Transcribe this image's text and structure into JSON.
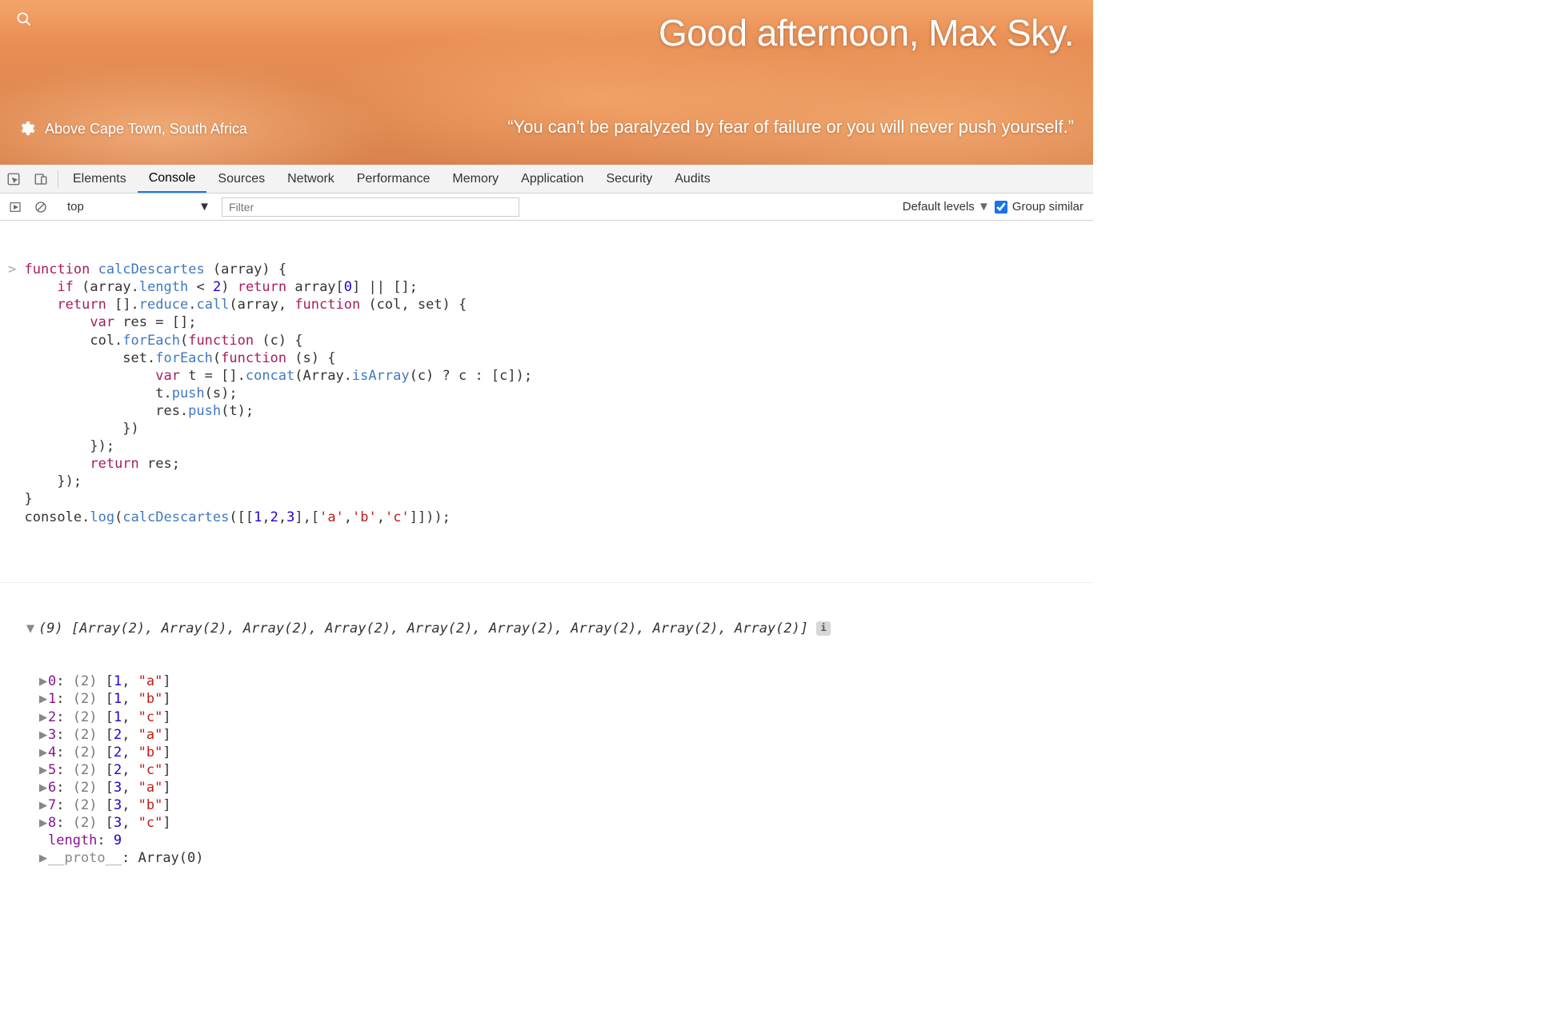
{
  "hero": {
    "greeting": "Good afternoon, Max Sky.",
    "quote": "“You can't be paralyzed by fear of failure or you will never push yourself.”",
    "location": "Above Cape Town, South Africa"
  },
  "devtools": {
    "tabs": [
      "Elements",
      "Console",
      "Sources",
      "Network",
      "Performance",
      "Memory",
      "Application",
      "Security",
      "Audits"
    ],
    "active_tab": "Console"
  },
  "console_toolbar": {
    "context": "top",
    "filter_placeholder": "Filter",
    "levels_label": "Default levels",
    "group_similar_label": "Group similar",
    "group_similar_checked": true
  },
  "code_tokens": [
    [
      [
        "prompt",
        "> "
      ],
      [
        "kw",
        "function"
      ],
      [
        "pl",
        " "
      ],
      [
        "nm",
        "calcDescartes"
      ],
      [
        "pl",
        " ("
      ],
      [
        "pl",
        "array"
      ],
      [
        "pl",
        ") {"
      ]
    ],
    [
      [
        "pl",
        "      "
      ],
      [
        "kw",
        "if"
      ],
      [
        "pl",
        " ("
      ],
      [
        "pl",
        "array"
      ],
      [
        "pl",
        "."
      ],
      [
        "nm",
        "length"
      ],
      [
        "pl",
        " < "
      ],
      [
        "num",
        "2"
      ],
      [
        "pl",
        ") "
      ],
      [
        "kw",
        "return"
      ],
      [
        "pl",
        " array["
      ],
      [
        "num",
        "0"
      ],
      [
        "pl",
        "] || [];"
      ]
    ],
    [
      [
        "pl",
        "      "
      ],
      [
        "kw",
        "return"
      ],
      [
        "pl",
        " []."
      ],
      [
        "nm",
        "reduce"
      ],
      [
        "pl",
        "."
      ],
      [
        "nm",
        "call"
      ],
      [
        "pl",
        "(array, "
      ],
      [
        "kw",
        "function"
      ],
      [
        "pl",
        " (col, set) {"
      ]
    ],
    [
      [
        "pl",
        "          "
      ],
      [
        "kw",
        "var"
      ],
      [
        "pl",
        " res = [];"
      ]
    ],
    [
      [
        "pl",
        "          col."
      ],
      [
        "nm",
        "forEach"
      ],
      [
        "pl",
        "("
      ],
      [
        "kw",
        "function"
      ],
      [
        "pl",
        " (c) {"
      ]
    ],
    [
      [
        "pl",
        "              set."
      ],
      [
        "nm",
        "forEach"
      ],
      [
        "pl",
        "("
      ],
      [
        "kw",
        "function"
      ],
      [
        "pl",
        " (s) {"
      ]
    ],
    [
      [
        "pl",
        "                  "
      ],
      [
        "kw",
        "var"
      ],
      [
        "pl",
        " t = []."
      ],
      [
        "nm",
        "concat"
      ],
      [
        "pl",
        "(Array."
      ],
      [
        "nm",
        "isArray"
      ],
      [
        "pl",
        "(c) ? c : [c]);"
      ]
    ],
    [
      [
        "pl",
        "                  t."
      ],
      [
        "nm",
        "push"
      ],
      [
        "pl",
        "(s);"
      ]
    ],
    [
      [
        "pl",
        "                  res."
      ],
      [
        "nm",
        "push"
      ],
      [
        "pl",
        "(t);"
      ]
    ],
    [
      [
        "pl",
        "              })"
      ]
    ],
    [
      [
        "pl",
        "          });"
      ]
    ],
    [
      [
        "pl",
        "          "
      ],
      [
        "kw",
        "return"
      ],
      [
        "pl",
        " res;"
      ]
    ],
    [
      [
        "pl",
        "      });"
      ]
    ],
    [
      [
        "pl",
        "  }"
      ]
    ],
    [
      [
        "pl",
        ""
      ]
    ],
    [
      [
        "pl",
        "  console."
      ],
      [
        "nm",
        "log"
      ],
      [
        "pl",
        "("
      ],
      [
        "nm",
        "calcDescartes"
      ],
      [
        "pl",
        "([["
      ],
      [
        "num",
        "1"
      ],
      [
        "pl",
        ","
      ],
      [
        "num",
        "2"
      ],
      [
        "pl",
        ","
      ],
      [
        "num",
        "3"
      ],
      [
        "pl",
        "],["
      ],
      [
        "val-str",
        "'a'"
      ],
      [
        "pl",
        ","
      ],
      [
        "val-str",
        "'b'"
      ],
      [
        "pl",
        ","
      ],
      [
        "val-str",
        "'c'"
      ],
      [
        "pl",
        "]]));"
      ]
    ]
  ],
  "result": {
    "summary_count": 9,
    "summary_text": "[Array(2), Array(2), Array(2), Array(2), Array(2), Array(2), Array(2), Array(2), Array(2)]",
    "items": [
      {
        "index": "0",
        "len": "(2)",
        "num": 1,
        "str": "\"a\""
      },
      {
        "index": "1",
        "len": "(2)",
        "num": 1,
        "str": "\"b\""
      },
      {
        "index": "2",
        "len": "(2)",
        "num": 1,
        "str": "\"c\""
      },
      {
        "index": "3",
        "len": "(2)",
        "num": 2,
        "str": "\"a\""
      },
      {
        "index": "4",
        "len": "(2)",
        "num": 2,
        "str": "\"b\""
      },
      {
        "index": "5",
        "len": "(2)",
        "num": 2,
        "str": "\"c\""
      },
      {
        "index": "6",
        "len": "(2)",
        "num": 3,
        "str": "\"a\""
      },
      {
        "index": "7",
        "len": "(2)",
        "num": 3,
        "str": "\"b\""
      },
      {
        "index": "8",
        "len": "(2)",
        "num": 3,
        "str": "\"c\""
      }
    ],
    "length_label": "length",
    "length_value": 9,
    "proto_label": "__proto__",
    "proto_value": "Array(0)"
  }
}
